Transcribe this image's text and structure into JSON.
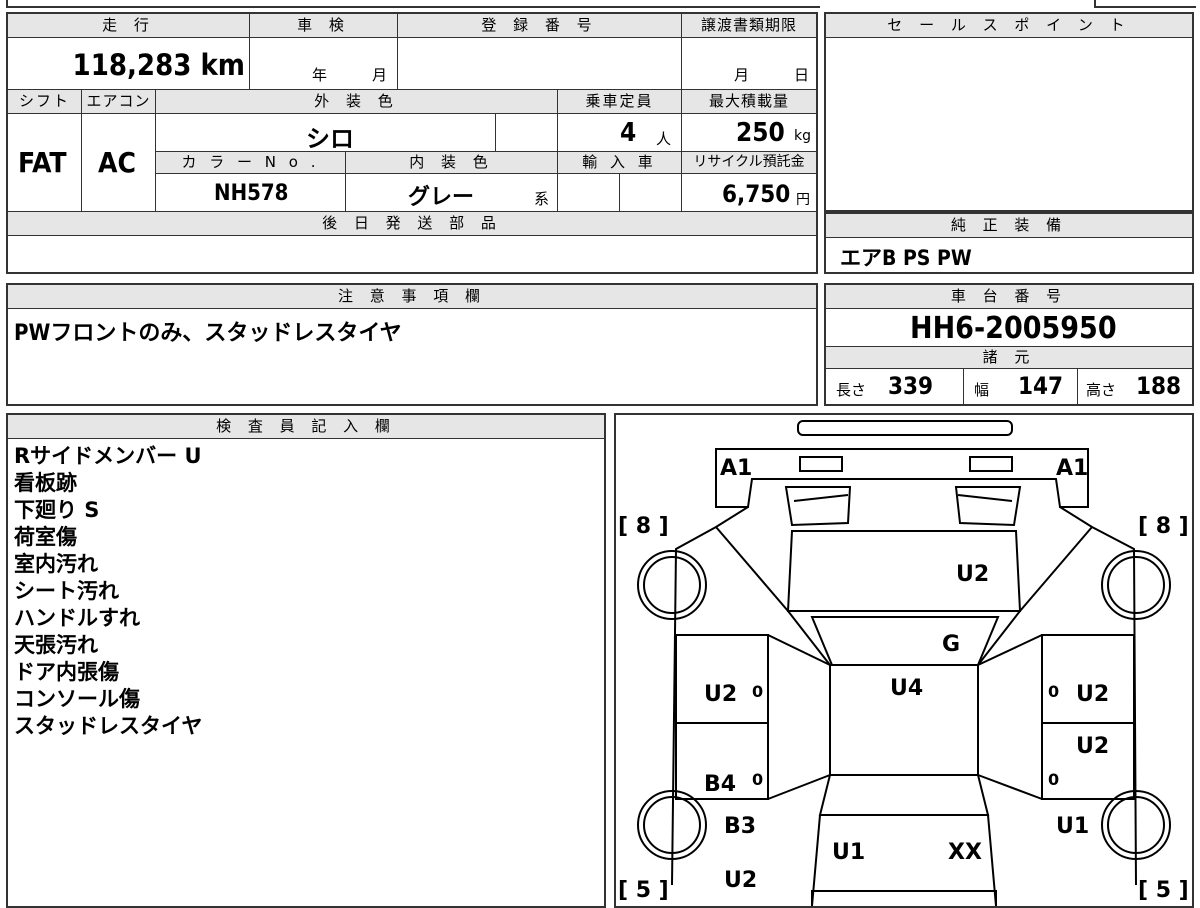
{
  "labels": {
    "mileage": "走 行",
    "inspection": "車 検",
    "registration": "登 録 番 号",
    "transfer_deadline": "譲渡書類期限",
    "shift": "シフト",
    "aircon": "エアコン",
    "exterior_color": "外 装 色",
    "capacity": "乗車定員",
    "max_load": "最大積載量",
    "color_no": "カ ラ ー N o .",
    "interior_color": "内 装 色",
    "import": "輸 入 車",
    "recycle_fee": "リサイクル預託金",
    "later_parts": "後 日 発 送 部 品",
    "sales_point": "セ ー ル ス ポ イ ン ト",
    "genuine_equipment": "純 正 装 備",
    "notes": "注 意 事 項 欄",
    "chassis_no": "車 台 番 号",
    "specs": "諸 元",
    "inspector": "検 査 員 記 入 欄"
  },
  "values": {
    "mileage": "118,283 km",
    "year_unit": "年",
    "month_unit": "月",
    "transfer_month": "月",
    "transfer_day": "日",
    "shift": "FAT",
    "aircon": "AC",
    "exterior_color": "シロ",
    "capacity": "4",
    "capacity_unit": "人",
    "max_load": "250",
    "max_load_unit": "kg",
    "color_no": "NH578",
    "interior_color": "グレー",
    "interior_suffix": "系",
    "recycle_fee": "6,750",
    "recycle_unit": "円",
    "genuine_equipment": "エアB PS PW",
    "notes": "PWフロントのみ、スタッドレスタイヤ",
    "chassis_no": "HH6-2005950",
    "length_label": "長さ",
    "length": "339",
    "width_label": "幅",
    "width": "147",
    "height_label": "高さ",
    "height": "188"
  },
  "inspector_notes": [
    "Rサイドメンバー U",
    "看板跡",
    "下廻り S",
    "荷室傷",
    "室内汚れ",
    "シート汚れ",
    "ハンドルすれ",
    "天張汚れ",
    "ドア内張傷",
    "コンソール傷",
    "スタッドレスタイヤ"
  ],
  "diagram": {
    "tire_fl": "[ 8 ]",
    "tire_fr": "[ 8 ]",
    "tire_rl": "[ 5 ]",
    "tire_rr": "[ 5 ]",
    "a1_left": "A1",
    "a1_right": "A1",
    "hood": "U2",
    "windshield": "G",
    "roof": "U4",
    "front_left": "U2",
    "front_right": "U2",
    "right_rear_door": "U2",
    "rear_left": "B4",
    "rear_left_corner": "B3",
    "rear_left_bottom": "U2",
    "rear_right_corner": "U1",
    "tailgate_left": "U1",
    "tailgate_right": "XX",
    "zero1": "0",
    "zero2": "0",
    "zero3": "0",
    "zero4": "0"
  }
}
